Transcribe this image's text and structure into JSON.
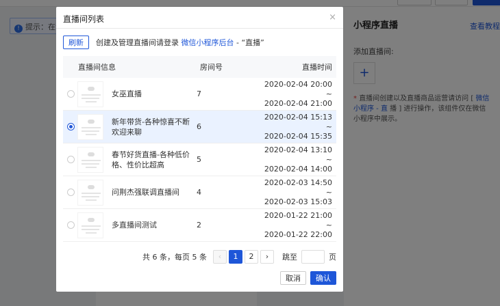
{
  "background": {
    "tip_prefix": "提示：在浏",
    "panel_title": "小程序直播",
    "view_link": "查看教程",
    "add_label": "添加直播间:",
    "add_icon": "plus-icon",
    "note_star": "*",
    "note_text_1": "直播间创建以及直播商品运营请访问 [",
    "note_link": "微信小程序 - 直",
    "note_text_2": "播 ] 进行操作，该组件仅在微信小程序中展示。"
  },
  "dialog": {
    "title": "直播间列表",
    "close_icon": "×",
    "refresh_label": "刷新",
    "hint_prefix": "创建及管理直播间请登录",
    "hint_link": "微信小程序后台",
    "hint_suffix": " - “直播”",
    "columns": {
      "info": "直播间信息",
      "room": "房间号",
      "time": "直播时间"
    },
    "rows": [
      {
        "name": "女巫直播",
        "room": "7",
        "time_start": "2020-02-04 20:00 ~",
        "time_end": "2020-02-04 21:00",
        "selected": false
      },
      {
        "name": "新年带货-各种惊喜不断欢迎来聊",
        "room": "6",
        "time_start": "2020-02-04 15:13 ~",
        "time_end": "2020-02-04 15:35",
        "selected": true
      },
      {
        "name": "春节好货直播-各种低价格、性价比超高",
        "room": "5",
        "time_start": "2020-02-04 13:10 ~",
        "time_end": "2020-02-04 14:00",
        "selected": false
      },
      {
        "name": "问荆杰强联调直播间",
        "room": "4",
        "time_start": "2020-02-03 14:50 ~",
        "time_end": "2020-02-03 15:03",
        "selected": false
      },
      {
        "name": "多直播间测试",
        "room": "2",
        "time_start": "2020-01-22 21:00 ~",
        "time_end": "2020-01-22 22:00",
        "selected": false
      }
    ],
    "pagination": {
      "total_text": "共 6 条，每页 5 条",
      "prev_icon": "‹",
      "pages": [
        "1",
        "2"
      ],
      "current_page": "1",
      "next_icon": "›",
      "jump_label": "跳至",
      "jump_value": "",
      "jump_unit": "页"
    },
    "cancel_label": "取消",
    "ok_label": "确认"
  },
  "colors": {
    "accent": "#1e56d8",
    "selected_row": "#eaf2ff"
  }
}
